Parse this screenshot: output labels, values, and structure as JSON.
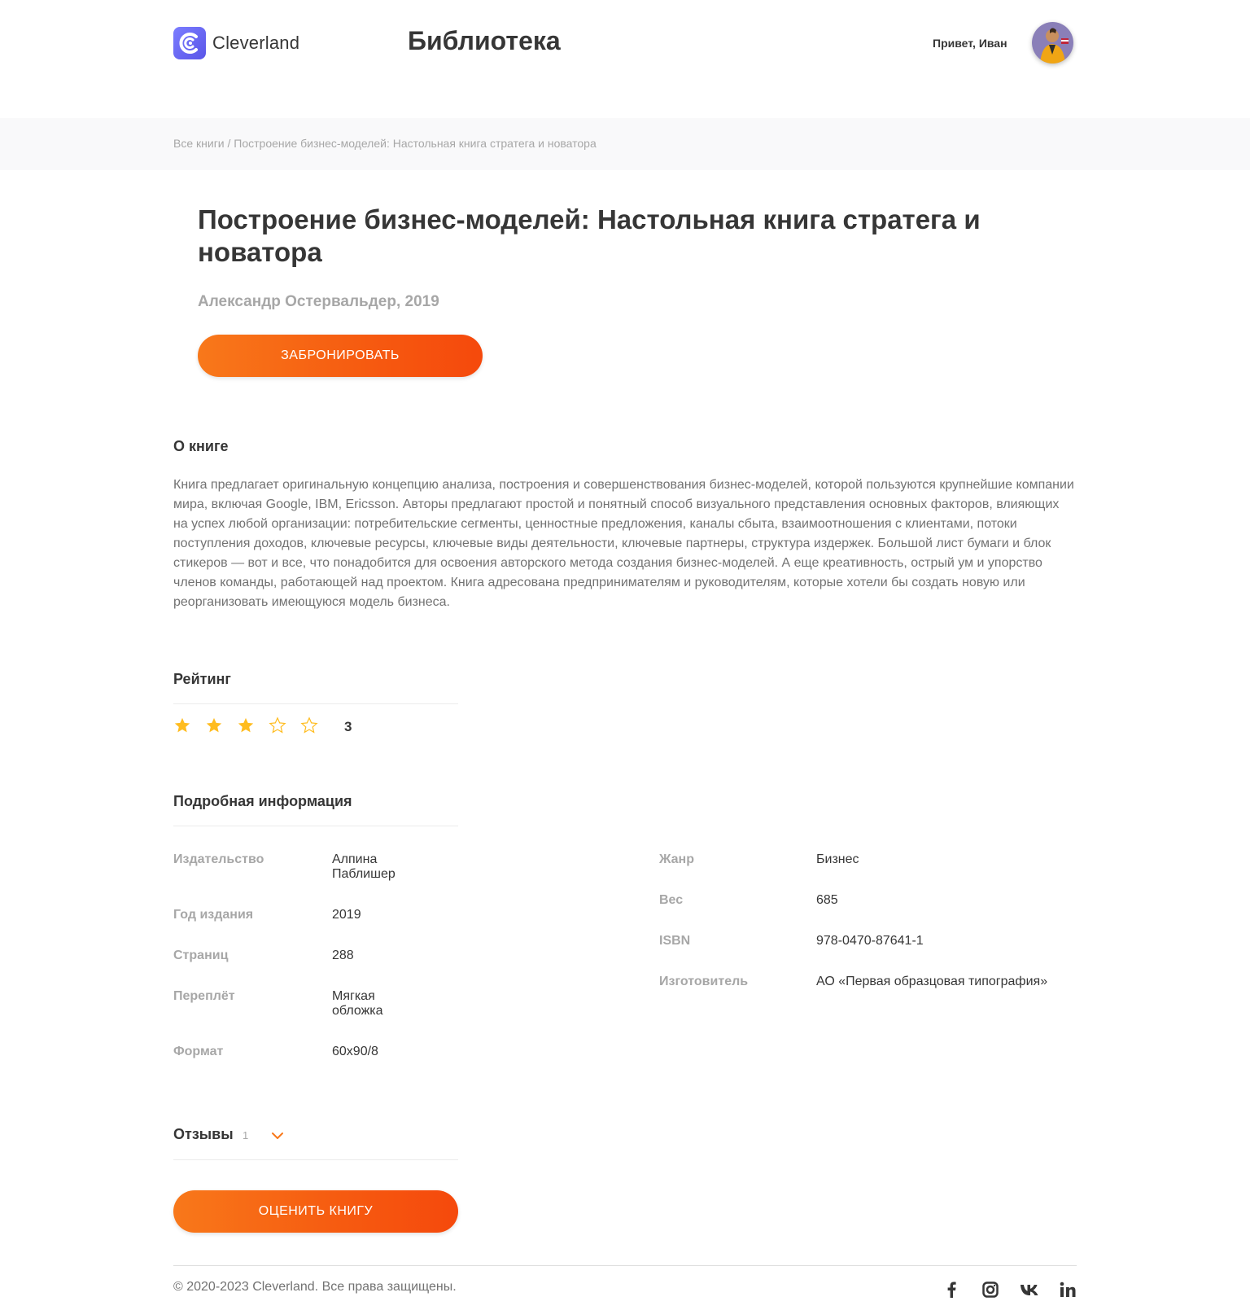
{
  "header": {
    "logo_text": "Cleverland",
    "page_title": "Библиотека",
    "greeting": "Привет, Иван"
  },
  "breadcrumb": {
    "root": "Все книги",
    "separator": " / ",
    "current": "Построение бизнес-моделей: Настольная книга стратега и новатора"
  },
  "book": {
    "title": "Построение бизнес-моделей: Настольная книга стратега и новатора",
    "author_year": "Александр Остервальдер, 2019",
    "reserve_button": "ЗАБРОНИРОВАТЬ"
  },
  "about": {
    "heading": "О книге",
    "text": "Книга предлагает оригинальную концепцию анализа, построения и совершенствования бизнес-моделей, которой пользуются крупнейшие компании мира, включая Google, IBM, Ericsson. Авторы предлагают простой и понятный способ визуального представления основных факторов, влияющих на успех любой организации: потребительские сегменты, ценностные предложения, каналы сбыта, взаимоотношения с клиентами, потоки поступления доходов, ключевые ресурсы, ключевые виды деятельности, ключевые партнеры, структура издержек. Большой лист бумаги и блок стикеров — вот и все, что понадобится для освоения авторского метода создания бизнес-моделей. А еще креативность, острый ум и упорство членов команды, работающей над проектом. Книга адресована предпринимателям и руководителям, которые хотели бы создать новую или реорганизовать имеющуюся модель бизнеса."
  },
  "rating": {
    "heading": "Рейтинг",
    "value": "3",
    "filled_stars": 3,
    "max_stars": 5,
    "star_color": "#ffbc1f"
  },
  "details": {
    "heading": "Подробная информация",
    "left": [
      {
        "label": "Издательство",
        "value": "Алпина Паблишер"
      },
      {
        "label": "Год издания",
        "value": "2019"
      },
      {
        "label": "Страниц",
        "value": "288"
      },
      {
        "label": "Переплёт",
        "value": "Мягкая обложка"
      },
      {
        "label": "Формат",
        "value": "60х90/8"
      }
    ],
    "right": [
      {
        "label": "Жанр",
        "value": "Бизнес"
      },
      {
        "label": "Вес",
        "value": "685"
      },
      {
        "label": "ISBN",
        "value": "978-0470-87641-1"
      },
      {
        "label": "Изготовитель",
        "value": "АО «Первая образцовая типография»"
      }
    ]
  },
  "reviews": {
    "heading": "Отзывы",
    "count": "1",
    "rate_button": "ОЦЕНИТЬ КНИГУ"
  },
  "footer": {
    "copyright": "© 2020-2023 Cleverland. Все права защищены.",
    "social_icons": [
      "facebook-icon",
      "instagram-icon",
      "vk-icon",
      "linkedin-icon"
    ]
  },
  "colors": {
    "accent_start": "#f8781a",
    "accent_end": "#f5490c",
    "logo": "#6c6cf5",
    "muted": "#a7a7a7"
  }
}
